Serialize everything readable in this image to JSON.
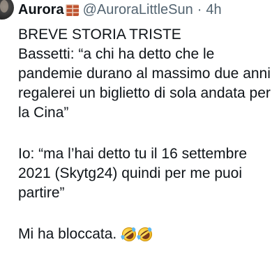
{
  "author": {
    "display_name": "Aurora",
    "badge_icon": "brick-icon",
    "handle": "@AuroraLittleSun",
    "separator": "·",
    "timestamp": "4h"
  },
  "tweet": {
    "lines": [
      "BREVE STORIA TRISTE",
      "Bassetti: “a chi ha detto che le",
      "pandemie durano al massimo due anni",
      "regalerei un biglietto di sola andata per",
      "la Cina”",
      "Io: “ma l’hai detto tu il 16 settembre",
      "2021 (Skytg24) quindi per me puoi",
      "partire”",
      "Mi ha bloccata."
    ],
    "emojis": [
      "rofl-icon",
      "rofl-icon"
    ]
  }
}
